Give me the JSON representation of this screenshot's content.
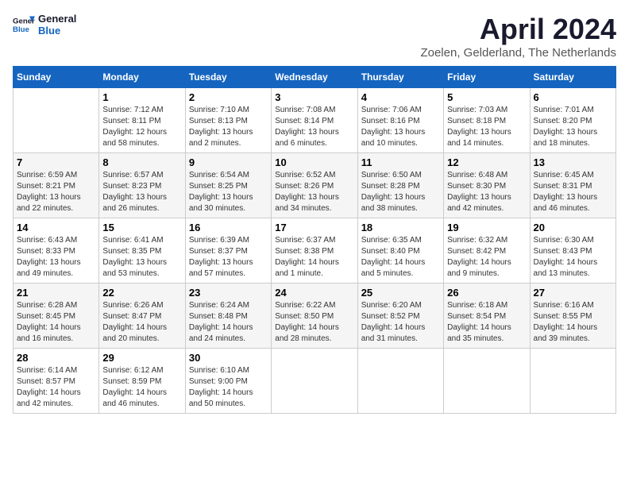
{
  "logo": {
    "line1": "General",
    "line2": "Blue"
  },
  "title": "April 2024",
  "subtitle": "Zoelen, Gelderland, The Netherlands",
  "days_header": [
    "Sunday",
    "Monday",
    "Tuesday",
    "Wednesday",
    "Thursday",
    "Friday",
    "Saturday"
  ],
  "weeks": [
    [
      {
        "day": "",
        "info": ""
      },
      {
        "day": "1",
        "info": "Sunrise: 7:12 AM\nSunset: 8:11 PM\nDaylight: 12 hours\nand 58 minutes."
      },
      {
        "day": "2",
        "info": "Sunrise: 7:10 AM\nSunset: 8:13 PM\nDaylight: 13 hours\nand 2 minutes."
      },
      {
        "day": "3",
        "info": "Sunrise: 7:08 AM\nSunset: 8:14 PM\nDaylight: 13 hours\nand 6 minutes."
      },
      {
        "day": "4",
        "info": "Sunrise: 7:06 AM\nSunset: 8:16 PM\nDaylight: 13 hours\nand 10 minutes."
      },
      {
        "day": "5",
        "info": "Sunrise: 7:03 AM\nSunset: 8:18 PM\nDaylight: 13 hours\nand 14 minutes."
      },
      {
        "day": "6",
        "info": "Sunrise: 7:01 AM\nSunset: 8:20 PM\nDaylight: 13 hours\nand 18 minutes."
      }
    ],
    [
      {
        "day": "7",
        "info": "Sunrise: 6:59 AM\nSunset: 8:21 PM\nDaylight: 13 hours\nand 22 minutes."
      },
      {
        "day": "8",
        "info": "Sunrise: 6:57 AM\nSunset: 8:23 PM\nDaylight: 13 hours\nand 26 minutes."
      },
      {
        "day": "9",
        "info": "Sunrise: 6:54 AM\nSunset: 8:25 PM\nDaylight: 13 hours\nand 30 minutes."
      },
      {
        "day": "10",
        "info": "Sunrise: 6:52 AM\nSunset: 8:26 PM\nDaylight: 13 hours\nand 34 minutes."
      },
      {
        "day": "11",
        "info": "Sunrise: 6:50 AM\nSunset: 8:28 PM\nDaylight: 13 hours\nand 38 minutes."
      },
      {
        "day": "12",
        "info": "Sunrise: 6:48 AM\nSunset: 8:30 PM\nDaylight: 13 hours\nand 42 minutes."
      },
      {
        "day": "13",
        "info": "Sunrise: 6:45 AM\nSunset: 8:31 PM\nDaylight: 13 hours\nand 46 minutes."
      }
    ],
    [
      {
        "day": "14",
        "info": "Sunrise: 6:43 AM\nSunset: 8:33 PM\nDaylight: 13 hours\nand 49 minutes."
      },
      {
        "day": "15",
        "info": "Sunrise: 6:41 AM\nSunset: 8:35 PM\nDaylight: 13 hours\nand 53 minutes."
      },
      {
        "day": "16",
        "info": "Sunrise: 6:39 AM\nSunset: 8:37 PM\nDaylight: 13 hours\nand 57 minutes."
      },
      {
        "day": "17",
        "info": "Sunrise: 6:37 AM\nSunset: 8:38 PM\nDaylight: 14 hours\nand 1 minute."
      },
      {
        "day": "18",
        "info": "Sunrise: 6:35 AM\nSunset: 8:40 PM\nDaylight: 14 hours\nand 5 minutes."
      },
      {
        "day": "19",
        "info": "Sunrise: 6:32 AM\nSunset: 8:42 PM\nDaylight: 14 hours\nand 9 minutes."
      },
      {
        "day": "20",
        "info": "Sunrise: 6:30 AM\nSunset: 8:43 PM\nDaylight: 14 hours\nand 13 minutes."
      }
    ],
    [
      {
        "day": "21",
        "info": "Sunrise: 6:28 AM\nSunset: 8:45 PM\nDaylight: 14 hours\nand 16 minutes."
      },
      {
        "day": "22",
        "info": "Sunrise: 6:26 AM\nSunset: 8:47 PM\nDaylight: 14 hours\nand 20 minutes."
      },
      {
        "day": "23",
        "info": "Sunrise: 6:24 AM\nSunset: 8:48 PM\nDaylight: 14 hours\nand 24 minutes."
      },
      {
        "day": "24",
        "info": "Sunrise: 6:22 AM\nSunset: 8:50 PM\nDaylight: 14 hours\nand 28 minutes."
      },
      {
        "day": "25",
        "info": "Sunrise: 6:20 AM\nSunset: 8:52 PM\nDaylight: 14 hours\nand 31 minutes."
      },
      {
        "day": "26",
        "info": "Sunrise: 6:18 AM\nSunset: 8:54 PM\nDaylight: 14 hours\nand 35 minutes."
      },
      {
        "day": "27",
        "info": "Sunrise: 6:16 AM\nSunset: 8:55 PM\nDaylight: 14 hours\nand 39 minutes."
      }
    ],
    [
      {
        "day": "28",
        "info": "Sunrise: 6:14 AM\nSunset: 8:57 PM\nDaylight: 14 hours\nand 42 minutes."
      },
      {
        "day": "29",
        "info": "Sunrise: 6:12 AM\nSunset: 8:59 PM\nDaylight: 14 hours\nand 46 minutes."
      },
      {
        "day": "30",
        "info": "Sunrise: 6:10 AM\nSunset: 9:00 PM\nDaylight: 14 hours\nand 50 minutes."
      },
      {
        "day": "",
        "info": ""
      },
      {
        "day": "",
        "info": ""
      },
      {
        "day": "",
        "info": ""
      },
      {
        "day": "",
        "info": ""
      }
    ]
  ]
}
